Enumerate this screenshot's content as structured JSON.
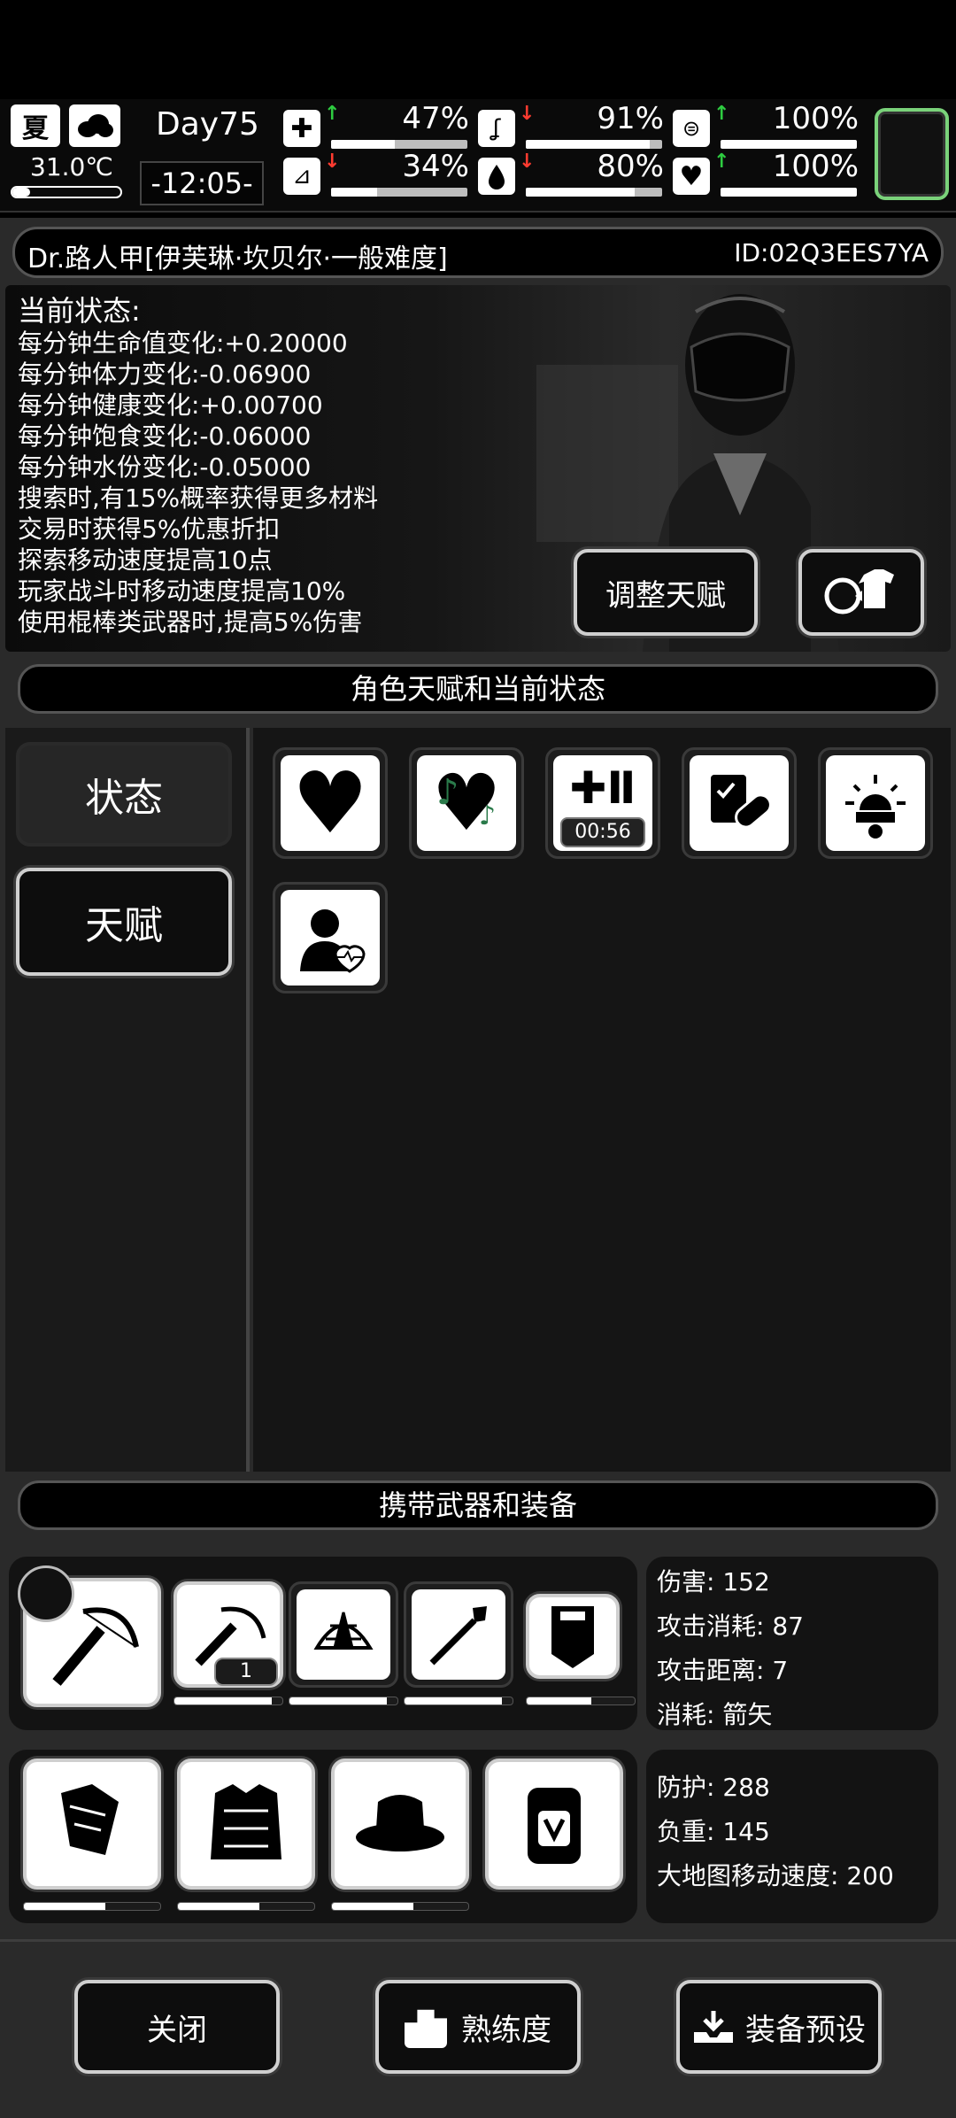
{
  "topbar": {
    "season": "夏",
    "temperature": "31.0℃",
    "day": "Day75",
    "clock": "-12:05-",
    "stats": [
      {
        "name": "health-kit",
        "pct": "47%",
        "trend": "up",
        "level": 0.47
      },
      {
        "name": "stomach",
        "pct": "91%",
        "trend": "down",
        "level": 0.91
      },
      {
        "name": "lungs",
        "pct": "100%",
        "trend": "up",
        "level": 1.0
      },
      {
        "name": "stamina-leg",
        "pct": "34%",
        "trend": "down",
        "level": 0.34
      },
      {
        "name": "water-drop",
        "pct": "80%",
        "trend": "down",
        "level": 0.8
      },
      {
        "name": "heart",
        "pct": "100%",
        "trend": "up",
        "level": 1.0
      }
    ]
  },
  "character": {
    "name": "Dr.路人甲[伊芙琳·坎贝尔·一般难度]",
    "id": "ID:02Q3EES7YA"
  },
  "status": {
    "heading": "当前状态:",
    "lines": [
      "每分钟生命值变化:+0.20000",
      "每分钟体力变化:-0.06900",
      "每分钟健康变化:+0.00700",
      "每分钟饱食变化:-0.06000",
      "每分钟水份变化:-0.05000",
      "搜索时,有15%概率获得更多材料",
      "交易时获得5%优惠折扣",
      "探索移动速度提高10点",
      "玩家战斗时移动速度提高10%",
      "使用棍棒类武器时,提高5%伤害"
    ],
    "adjust_talent_label": "调整天赋"
  },
  "talent_section": {
    "title": "角色天赋和当前状态",
    "tabs": [
      "状态",
      "天赋"
    ],
    "buff_timer": "00:56"
  },
  "equipment_section": {
    "title": "携带武器和装备",
    "ammo_count": "1",
    "weapon_stats": [
      "伤害: 152",
      "攻击消耗: 87",
      "攻击距离: 7",
      "消耗: 箭矢"
    ],
    "armor_stats": [
      "防护: 288",
      "负重: 145",
      "大地图移动速度: 200"
    ]
  },
  "bottom": {
    "close": "关闭",
    "proficiency": "熟练度",
    "preset": "装备预设"
  }
}
